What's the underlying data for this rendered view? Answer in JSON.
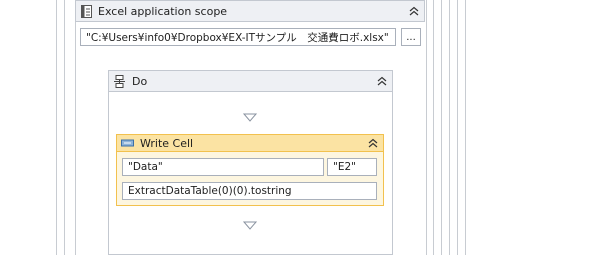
{
  "excel_scope": {
    "title": "Excel application scope",
    "path_value": "\"C:¥Users¥info0¥Dropbox¥EX-ITサンプル　交通費ロボ.xlsx\"",
    "browse_label": "..."
  },
  "do_sequence": {
    "title": "Do"
  },
  "write_cell": {
    "title": "Write Cell",
    "sheet_value": "\"Data\"",
    "cell_value": "\"E2\"",
    "value_expression": "ExtractDataTable(0)(0).tostring"
  },
  "icons": {
    "excel_scope": "excel-document-icon",
    "do": "sequence-icon",
    "write_cell": "write-cell-icon",
    "collapse": "chevron-up-double-icon",
    "drop_target": "drop-arrow-icon"
  },
  "colors": {
    "activity_accent": "#f2c14e",
    "activity_header": "#fbe3a3",
    "activity_body": "#fdf6e0",
    "container_header": "#eef0f4",
    "border": "#c3c8d0"
  }
}
